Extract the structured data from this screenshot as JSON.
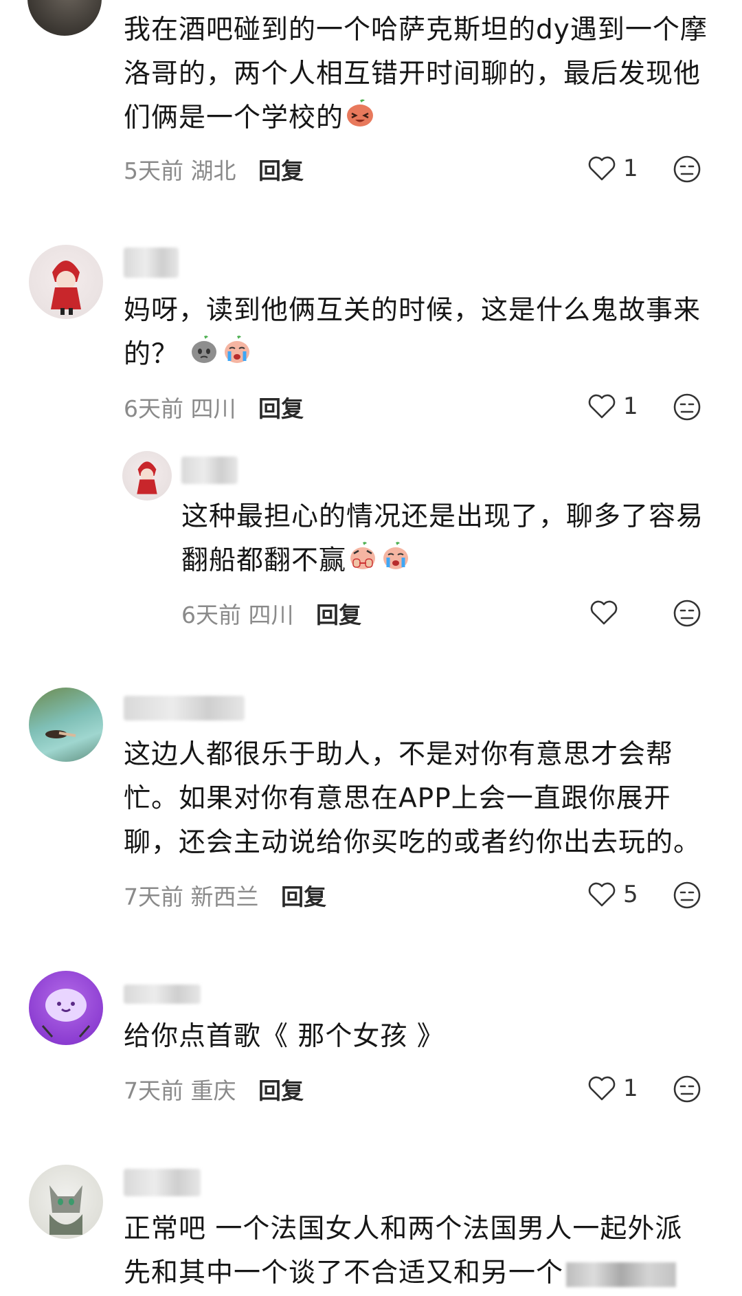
{
  "comments": [
    {
      "lines": [
        "我在酒吧碰到的一个哈萨克斯坦的dy遇到一个摩",
        "洛哥的，两个人相互错开时间聊的，最后发现他",
        "们俩是一个学校的"
      ],
      "emoji_names": [
        "laugh-emoji"
      ],
      "time": "5天前",
      "location": "湖北",
      "reply_label": "回复",
      "likes": "1"
    },
    {
      "lines": [
        "妈呀，读到他俩互关的时候，这是什么鬼故事来",
        "的？"
      ],
      "emoji_names": [
        "rock-emoji",
        "cry-emoji"
      ],
      "time": "6天前",
      "location": "四川",
      "reply_label": "回复",
      "likes": "1",
      "reply": {
        "lines": [
          "这种最担心的情况还是出现了，聊多了容易",
          "翻船都翻不赢"
        ],
        "emoji_names": [
          "cover-face-emoji",
          "cry-emoji"
        ],
        "time": "6天前",
        "location": "四川",
        "reply_label": "回复",
        "likes": ""
      }
    },
    {
      "lines": [
        "这边人都很乐于助人，不是对你有意思才会帮",
        "忙。如果对你有意思在APP上会一直跟你展开",
        "聊，还会主动说给你买吃的或者约你出去玩的。"
      ],
      "emoji_names": [],
      "time": "7天前",
      "location": "新西兰",
      "reply_label": "回复",
      "likes": "5"
    },
    {
      "lines": [
        "给你点首歌《 那个女孩 》"
      ],
      "emoji_names": [],
      "time": "7天前",
      "location": "重庆",
      "reply_label": "回复",
      "likes": "1"
    },
    {
      "lines": [
        "正常吧 一个法国女人和两个法国男人一起外派",
        "先和其中一个谈了不合适又和另一个"
      ],
      "emoji_names": [],
      "time": "",
      "location": "",
      "reply_label": "",
      "likes": ""
    }
  ],
  "colors": {
    "text": "#161616",
    "meta": "#8a8a8a",
    "reply": "#2a2a2a",
    "background": "#ffffff"
  }
}
